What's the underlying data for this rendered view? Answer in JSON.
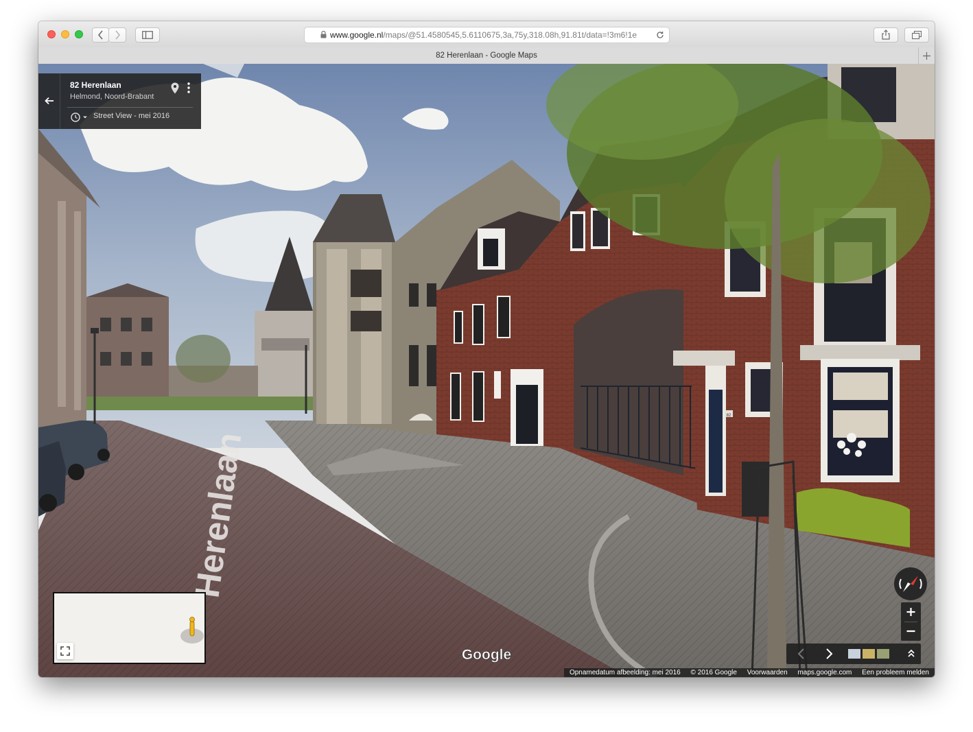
{
  "browser": {
    "url_domain": "www.google.nl",
    "url_path": "/maps/@51.4580545,5.6110675,3a,75y,318.08h,91.81t/data=!3m6!1e",
    "tab_title": "82 Herenlaan - Google Maps"
  },
  "place": {
    "title": "82 Herenlaan",
    "subtitle": "Helmond, Noord-Brabant",
    "street_view_date": "Street View - mei 2016"
  },
  "scene": {
    "street_label": "Herenlaan",
    "house_number": "82",
    "google_logo": "Google"
  },
  "attribution": {
    "capture_date": "Opnamedatum afbeelding: mei 2016",
    "copyright": "© 2016 Google",
    "terms": "Voorwaarden",
    "site": "maps.google.com",
    "report": "Een probleem melden"
  },
  "icons": [
    "back-arrow-icon",
    "pin-icon",
    "more-vert-icon",
    "history-clock-icon",
    "compass-icon",
    "zoom-in-icon",
    "zoom-out-icon",
    "prev-icon",
    "next-icon",
    "expand-icon",
    "fullscreen-icon",
    "pegman-icon",
    "lock-icon",
    "reload-icon",
    "share-icon",
    "tabs-icon",
    "sidebar-icon",
    "new-tab-icon"
  ],
  "colors": {
    "brick": "#7a3b2e",
    "panel": "#212121",
    "sky": "#8fa6c4"
  }
}
